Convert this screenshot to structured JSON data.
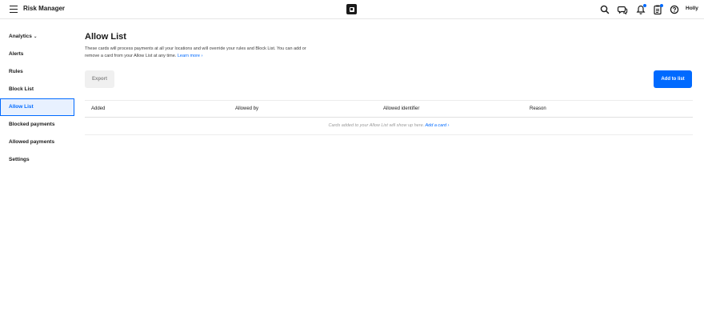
{
  "topbar": {
    "app_title": "Risk Manager",
    "user_name": "Holly",
    "icons": [
      "menu-icon",
      "square-logo",
      "search-icon",
      "messages-icon",
      "notifications-icon",
      "clipboard-icon",
      "help-icon"
    ],
    "accent_color": "#006aff"
  },
  "sidebar": {
    "items": [
      {
        "label": "Analytics",
        "has_chevron": true
      },
      {
        "label": "Alerts"
      },
      {
        "label": "Rules"
      },
      {
        "label": "Block List"
      },
      {
        "label": "Allow List",
        "active": true
      },
      {
        "label": "Blocked payments"
      },
      {
        "label": "Allowed payments"
      },
      {
        "label": "Settings"
      }
    ]
  },
  "main": {
    "title": "Allow List",
    "description": "These cards will process payments at all your locations and will override your rules and Block List. You can add or remove a card from your Allow List at any time.",
    "learn_more": "Learn more ›",
    "export_label": "Export",
    "add_label": "Add to list",
    "table": {
      "columns": [
        "Added",
        "Allowed by",
        "Allowed identifier",
        "Reason"
      ],
      "empty_text": "Cards added to your Allow List will show up here.",
      "empty_link": "Add a card ›"
    }
  }
}
